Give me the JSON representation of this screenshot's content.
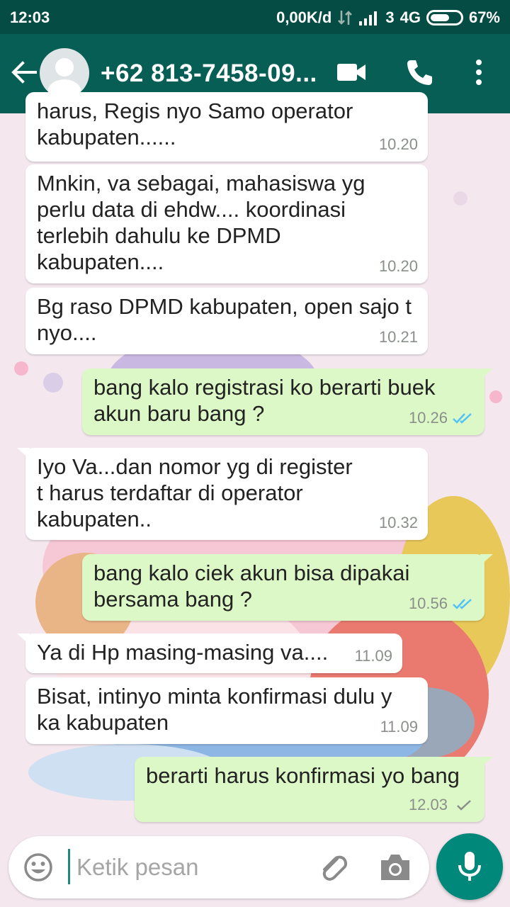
{
  "status_bar": {
    "time": "12:03",
    "network_speed": "0,00K/d",
    "sim": "3",
    "network_type": "4G",
    "battery": "67%"
  },
  "header": {
    "contact_name": "+62 813-7458-09..."
  },
  "messages": [
    {
      "direction": "in",
      "text": "harus, Regis nyo Samo operator\nkabupaten......",
      "time": "10.20"
    },
    {
      "direction": "in",
      "text": "Mnkin, va sebagai, mahasiswa yg\nperlu data di ehdw.... koordinasi\nterlebih dahulu ke DPMD\nkabupaten....",
      "time": "10.20"
    },
    {
      "direction": "in",
      "text": "Bg raso DPMD kabupaten, open sajo t\nnyo....",
      "time": "10.21"
    },
    {
      "direction": "out",
      "text": "bang kalo registrasi ko berarti buek\nakun baru bang ?",
      "time": "10.26",
      "status": "read"
    },
    {
      "direction": "in",
      "text": "Iyo Va...dan nomor yg di register\nt harus terdaftar di operator\nkabupaten..",
      "time": "10.32"
    },
    {
      "direction": "out",
      "text": "bang kalo ciek akun bisa dipakai\nbersama bang ?",
      "time": "10.56",
      "status": "read"
    },
    {
      "direction": "in",
      "text": "Ya di Hp masing-masing va....",
      "time": "11.09"
    },
    {
      "direction": "in",
      "text": "Bisat, intinyo minta konfirmasi dulu y\nka kabupaten",
      "time": "11.09"
    },
    {
      "direction": "out",
      "text": "berarti harus konfirmasi yo bang",
      "time": "12.03",
      "status": "sent"
    }
  ],
  "composer": {
    "placeholder": "Ketik pesan"
  },
  "colors": {
    "status_bar": "#054d44",
    "app_bar": "#075e54",
    "outgoing_bubble": "#dcf8c6",
    "incoming_bubble": "#ffffff",
    "read_ticks": "#4fc3f7",
    "mic_button": "#00897b"
  },
  "icons": [
    "back-arrow-icon",
    "video-call-icon",
    "phone-icon",
    "more-vert-icon",
    "emoji-icon",
    "attach-icon",
    "camera-icon",
    "mic-icon"
  ]
}
